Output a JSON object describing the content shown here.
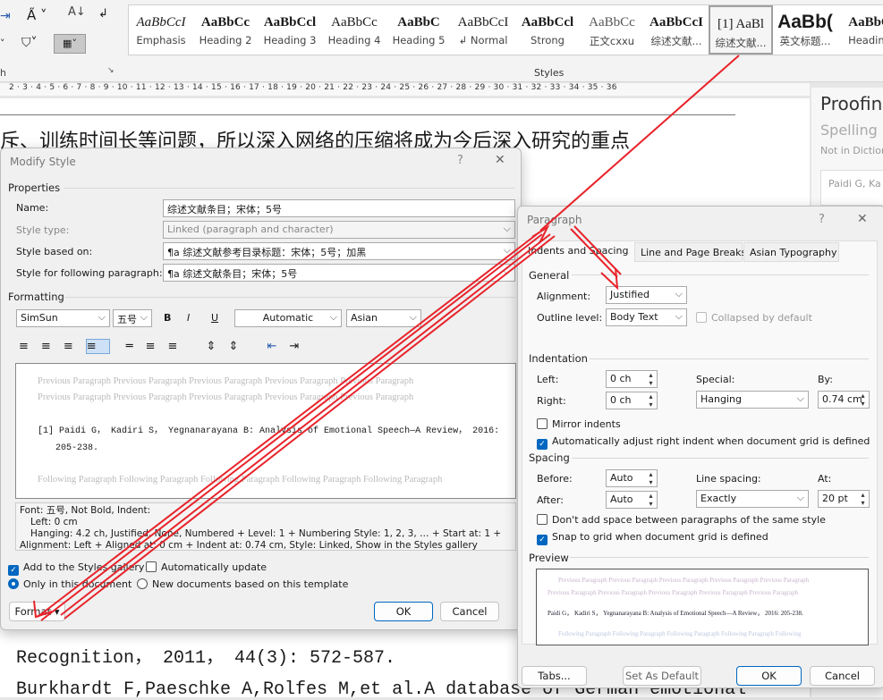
{
  "ribbon": {
    "styles_label": "Styles",
    "paragraph_label": "h",
    "gallery": [
      {
        "preview": "AaBbCcI",
        "label": "Emphasis",
        "style": "italic"
      },
      {
        "preview": "AaBbCc",
        "label": "Heading 2",
        "style": "bold"
      },
      {
        "preview": "AaBbCcl",
        "label": "Heading 3",
        "style": "bold"
      },
      {
        "preview": "AaBbCc",
        "label": "Heading 4",
        "style": "normal"
      },
      {
        "preview": "AaBbC",
        "label": "Heading 5",
        "style": "bold"
      },
      {
        "preview": "AaBbCcI",
        "label": "↲ Normal",
        "style": "normal"
      },
      {
        "preview": "AaBbCcl",
        "label": "Strong",
        "style": "bold"
      },
      {
        "preview": "AaBbCc",
        "label": "正文cxxu",
        "style": "light"
      },
      {
        "preview": "AaBbCcI",
        "label": "综述文献...",
        "style": "bold"
      },
      {
        "preview": "[1]  AaBl",
        "label": "综述文献...",
        "style": "normal",
        "selected": true
      },
      {
        "preview": "AaBb(",
        "label": "英文标题...",
        "style": "big"
      },
      {
        "preview": "AaBbC",
        "label": "Heading",
        "style": "bold"
      }
    ]
  },
  "ruler": {
    "ticks": "2 · 3 · 4 · 5 · 6 · 7 · 8 · 9 · 10 · 11 · 12 · 13 · 14 · 15 · 16 · 17 · 18 · 19 · 20 · 21 · 22 · 23 · 24 · 25 · 26 · 27 · 28 · 29 · 30 · 31 ·  32 · 33 · 34 · 35 · 36"
  },
  "document": {
    "line1": "斥、训练时间长等问题，所以深入网络的压缩将成为今后深入研究的重点",
    "line2": "Recognition， 2011， 44(3): 572-587.",
    "line3": "Burkhardt F,Paeschke A,Rolfes M,et al.A database of German emotional"
  },
  "proofing": {
    "title": "Proofing",
    "spelling": "Spelling",
    "not_in_dict": "Not in Diction",
    "suggestion": "Paidi G, Ka"
  },
  "modify_style": {
    "title": "Modify Style",
    "help": "?",
    "close": "✕",
    "properties": "Properties",
    "name_label": "Name:",
    "name_value": "综述文献条目；宋体；5号",
    "type_label": "Style type:",
    "type_value": "Linked (paragraph and character)",
    "based_label": "Style based on:",
    "based_value": "¶a 综述文献参考目录标题：宋体；5号；加黑",
    "following_label": "Style for following paragraph:",
    "following_value": "¶a 综述文献条目；宋体；5号",
    "formatting": "Formatting",
    "font": "SimSun",
    "size": "五号",
    "bold": "B",
    "italic": "I",
    "underline": "U",
    "color": "Automatic",
    "script": "Asian",
    "preview_prev1": "Previous Paragraph Previous Paragraph Previous Paragraph Previous Paragraph Previous Paragraph",
    "preview_prev2": "Previous Paragraph Previous Paragraph Previous Paragraph Previous Paragraph Previous Paragraph",
    "preview_main1": "[1] Paidi G， Kadiri S， Yegnanarayana B: Analysis of Emotional Speech—A Review， 2016:",
    "preview_main2": "205-238.",
    "preview_next": "Following Paragraph Following Paragraph Following Paragraph Following Paragraph Following Paragraph",
    "desc1": "Font: 五号, Not Bold, Indent:",
    "desc2": "Left:  0 cm",
    "desc3": "Hanging:  4.2 ch, Justified, None, Numbered + Level: 1 + Numbering Style: 1, 2, 3, … + Start at: 1 +",
    "desc4": "Alignment: Left + Aligned at:  0 cm + Indent at:  0.74 cm, Style: Linked, Show in the Styles gallery",
    "add_gallery": "Add to the Styles gallery",
    "add_gallery_checked": true,
    "auto_update": "Automatically update",
    "auto_update_checked": false,
    "only_doc": "Only in this document",
    "new_docs": "New documents based on this template",
    "format": "Format ▾",
    "ok": "OK",
    "cancel": "Cancel"
  },
  "paragraph": {
    "title": "Paragraph",
    "help": "?",
    "close": "✕",
    "tabs": [
      "Indents and Spacing",
      "Line and Page Breaks",
      "Asian Typography"
    ],
    "general": "General",
    "alignment_label": "Alignment:",
    "alignment": "Justified",
    "outline_label": "Outline level:",
    "outline": "Body Text",
    "collapsed": "Collapsed by default",
    "indentation": "Indentation",
    "left_label": "Left:",
    "left": "0 ch",
    "right_label": "Right:",
    "right": "0 ch",
    "special_label": "Special:",
    "special": "Hanging",
    "by_label": "By:",
    "by": "0.74 cm",
    "mirror": "Mirror indents",
    "mirror_checked": false,
    "auto_adjust": "Automatically adjust right indent when document grid is defined",
    "auto_adjust_checked": true,
    "spacing": "Spacing",
    "before_label": "Before:",
    "before": "Auto",
    "after_label": "After:",
    "after": "Auto",
    "line_spacing_label": "Line spacing:",
    "line_spacing": "Exactly",
    "at_label": "At:",
    "at": "20 pt",
    "dont_add": "Don't add space between paragraphs of the same style",
    "dont_add_checked": false,
    "snap": "Snap to grid when document grid is defined",
    "snap_checked": true,
    "preview": "Preview",
    "pv_prev1": "Previous Paragraph Previous Paragraph Previous Paragraph Previous Paragraph Previous Paragraph",
    "pv_prev2": "Previous Paragraph Previous Paragraph Previous Paragraph Previous Paragraph Previous Paragraph",
    "pv_main": "Paidi G， Kadiri S， Yegnanarayana B: Analysis of Emotional Speech—A Review， 2016: 205-238.",
    "pv_next": "Following Paragraph Following Paragraph Following Paragraph Following Paragraph Following",
    "tabs_btn": "Tabs...",
    "default_btn": "Set As Default",
    "ok": "OK",
    "cancel": "Cancel"
  },
  "annotation_color": "#e8232a"
}
